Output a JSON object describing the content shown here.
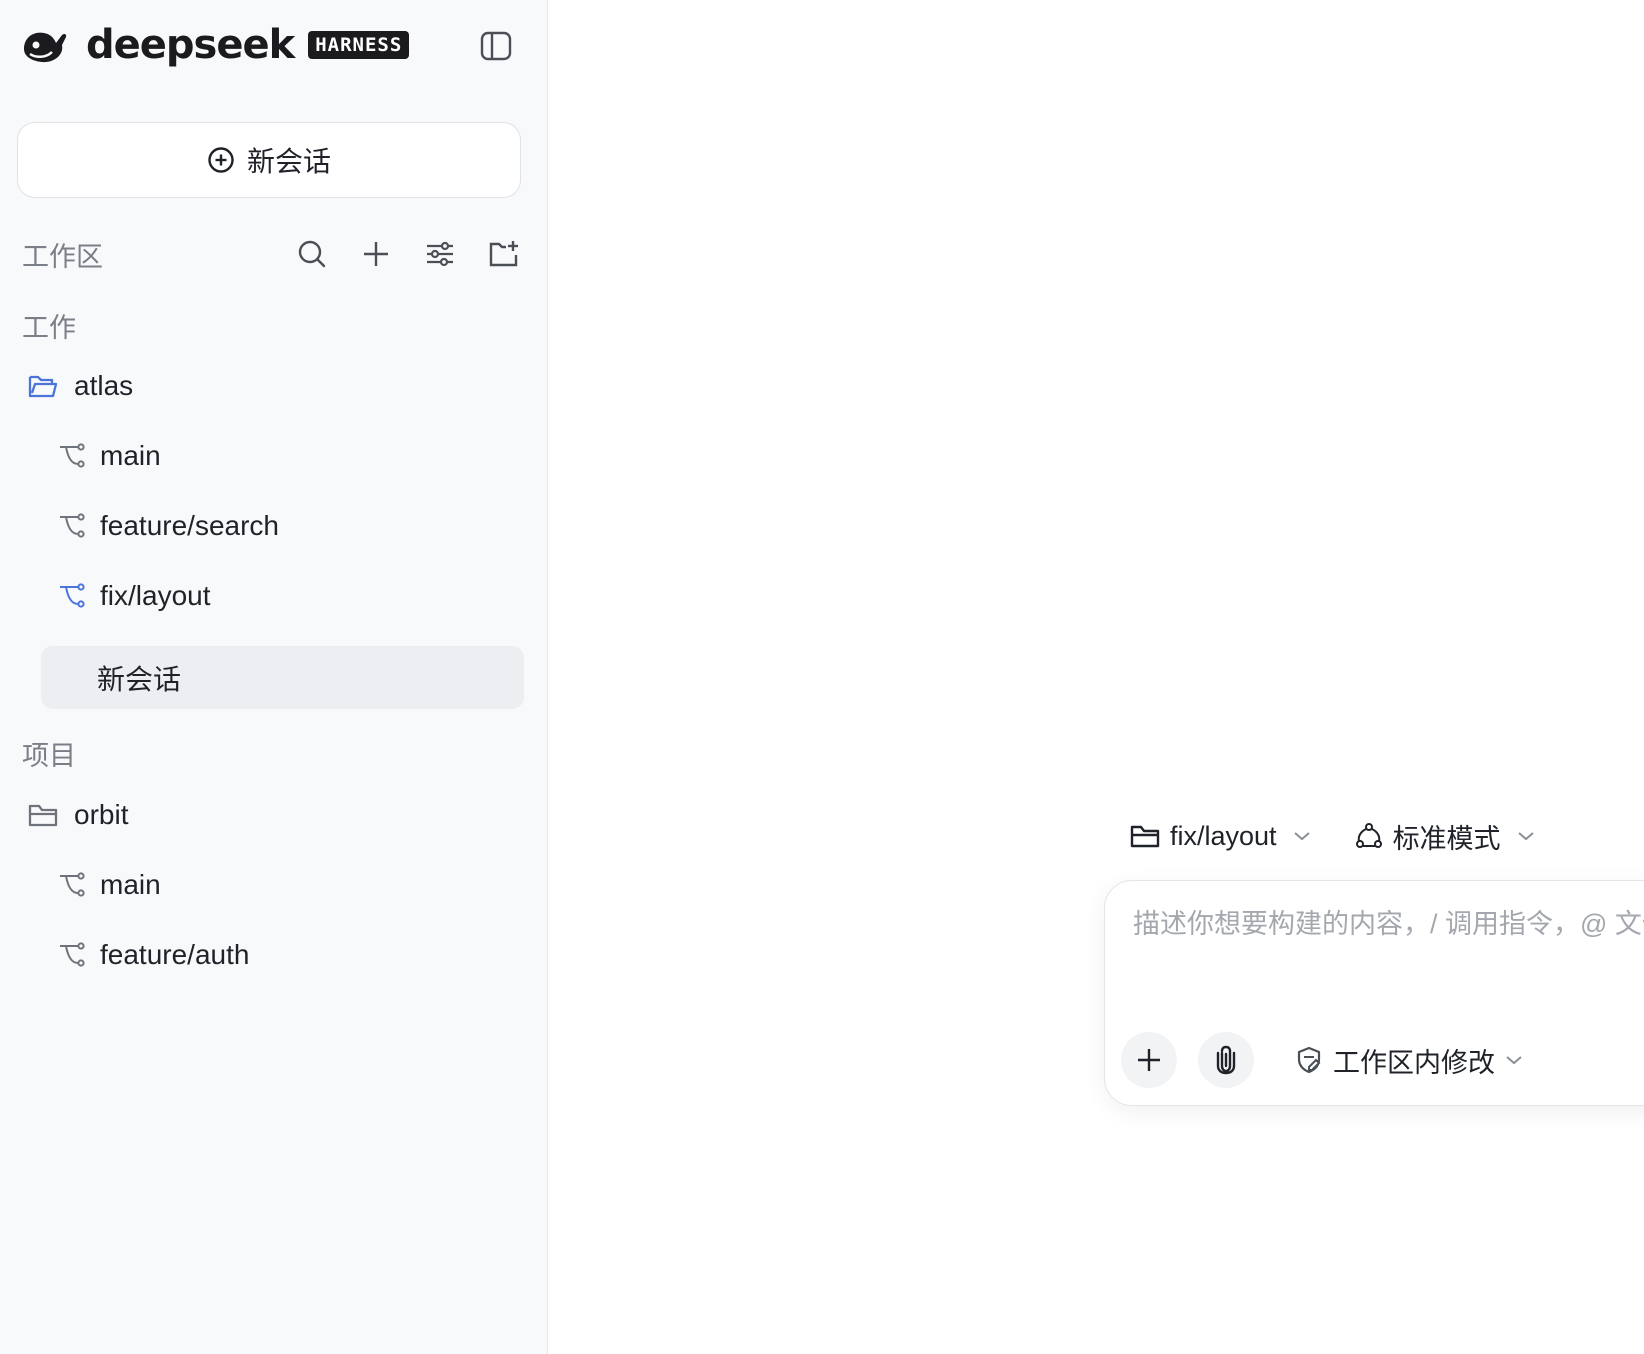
{
  "brand": {
    "name": "deepseek",
    "badge": "HARNESS"
  },
  "sidebar": {
    "new_chat_label": "新会话",
    "workspace_title": "工作区",
    "groups": [
      {
        "label": "工作",
        "repo": "atlas",
        "branches": [
          "main",
          "feature/search",
          "fix/layout"
        ],
        "session": "新会话"
      },
      {
        "label": "项目",
        "repo": "orbit",
        "branches": [
          "main",
          "feature/auth"
        ]
      }
    ]
  },
  "composer": {
    "branch_selector": "fix/layout",
    "mode_selector": "标准模式",
    "placeholder": "描述你想要构建的内容，/ 调用指令，@ 文件",
    "permission_label": "工作区内修改"
  },
  "colors": {
    "accent": "#4a74d9",
    "sidebar_bg": "#f8f9fb",
    "selected_bg": "#eceef1"
  }
}
